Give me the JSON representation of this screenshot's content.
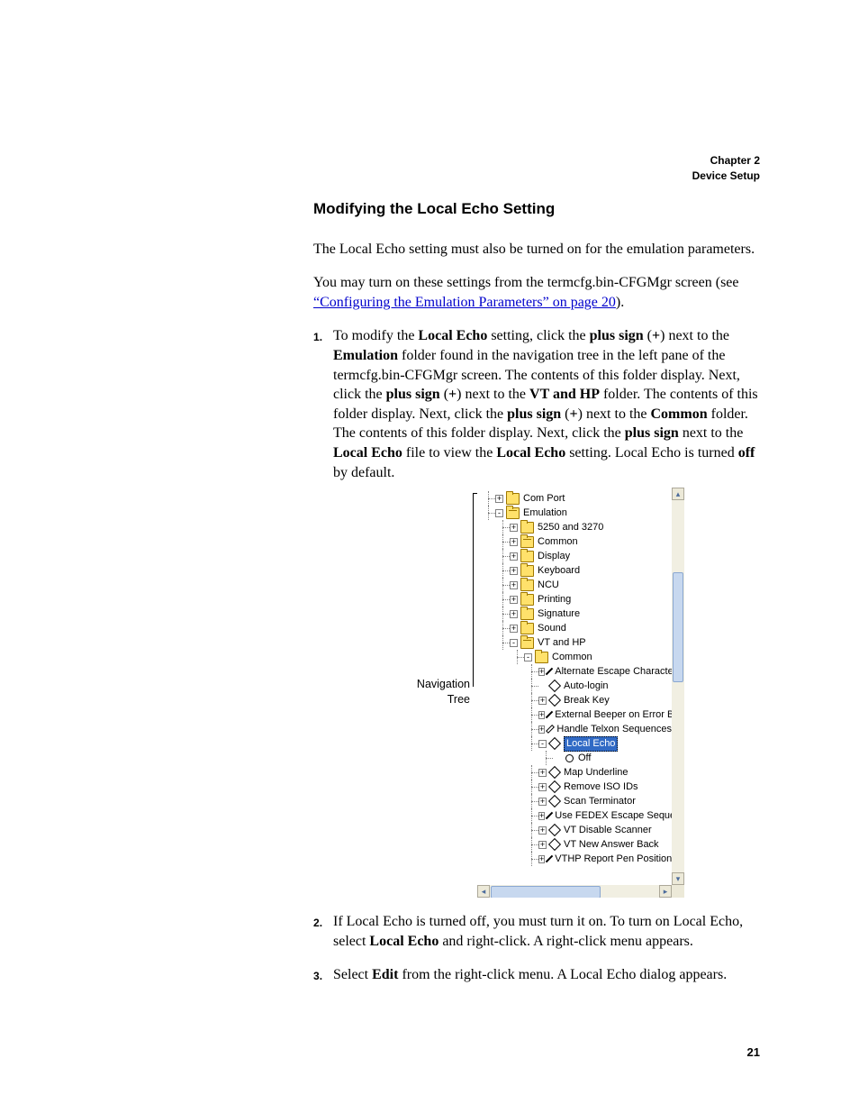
{
  "header": {
    "line1": "Chapter 2",
    "line2": "Device Setup"
  },
  "section_title": "Modifying the Local Echo Setting",
  "para1": "The Local Echo setting must also be turned on for the emulation parameters.",
  "para2_pre": "You may turn on these settings from the termcfg.bin-CFGMgr screen (see ",
  "para2_link": "“Configuring the Emulation Parameters” on page 20",
  "para2_post": ").",
  "step1": {
    "t1": "To modify the ",
    "b1": "Local Echo",
    "t2": " setting, click the ",
    "b2": "plus sign",
    "t3": " (",
    "b3": "+",
    "t4": ") next to the ",
    "b4": "Emulation",
    "t5": " folder found in the navigation tree in the left pane of the termcfg.bin-CFGMgr screen. The contents of this folder display. Next, click the ",
    "b5": "plus sign",
    "t6": " (",
    "b6": "+",
    "t7": ") next to the ",
    "b7": "VT and HP",
    "t8": " folder. The contents of this folder display. Next, click the ",
    "b8": "plus sign",
    "t9": " (",
    "b9": "+",
    "t10": ") next to the ",
    "b10": "Common",
    "t11": " folder. The contents of this folder display. Next, click the ",
    "b11": "plus sign",
    "t12": " next to the ",
    "b12": "Local Echo",
    "t13": " file to view the ",
    "b13": "Local Echo",
    "t14": " setting. Local Echo is turned ",
    "b14": "off",
    "t15": " by default."
  },
  "nav_label": {
    "l1": "Navigation",
    "l2": "Tree"
  },
  "tree": {
    "com_port": "Com Port",
    "emulation": "Emulation",
    "e1": "5250 and 3270",
    "e2": "Common",
    "e3": "Display",
    "e4": "Keyboard",
    "e5": "NCU",
    "e6": "Printing",
    "e7": "Signature",
    "e8": "Sound",
    "e9": "VT and HP",
    "common": "Common",
    "c1": "Alternate Escape Character",
    "c2": "Auto-login",
    "c3": "Break Key",
    "c4": "External Beeper on Error Bee",
    "c5": "Handle Telxon Sequences",
    "c6": "Local Echo",
    "c6a": "Off",
    "c7": "Map Underline",
    "c8": "Remove ISO IDs",
    "c9": "Scan Terminator",
    "c10": "Use FEDEX Escape Sequence",
    "c11": "VT Disable Scanner",
    "c12": "VT New Answer Back",
    "c13": "VTHP Report Pen Position"
  },
  "step2": {
    "t1": "If Local Echo is turned off, you must turn it on. To turn on Local Echo, select ",
    "b1": "Local Echo",
    "t2": " and right-click. A right-click menu appears."
  },
  "step3": {
    "t1": "Select ",
    "b1": "Edit",
    "t2": " from the right-click menu. A Local Echo dialog appears."
  },
  "page_number": "21"
}
